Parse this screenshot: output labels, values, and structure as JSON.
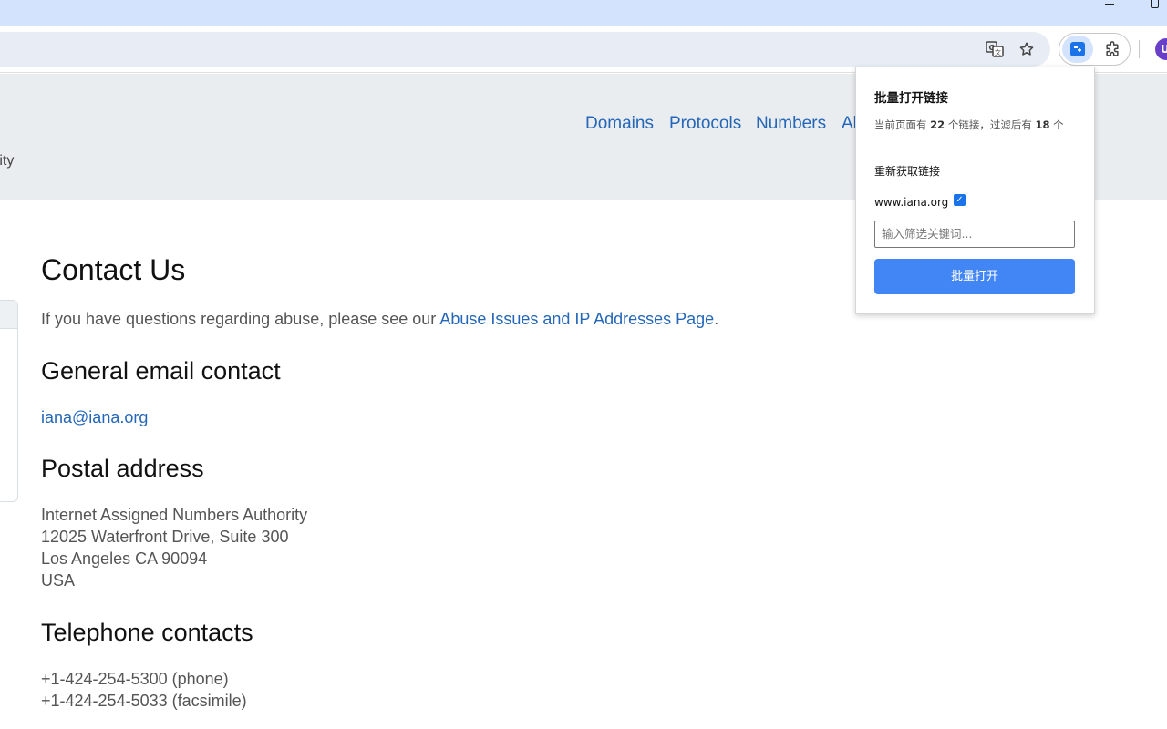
{
  "site": {
    "logo_text_fragment": "rity",
    "nav": {
      "domains": "Domains",
      "protocols": "Protocols",
      "numbers": "Numbers",
      "about_fragment": "Al"
    }
  },
  "main": {
    "title": "Contact Us",
    "abuse_intro": "If you have questions regarding abuse, please see our ",
    "abuse_link": "Abuse Issues and IP Addresses Page",
    "abuse_end": ".",
    "email_heading": "General email contact",
    "email": "iana@iana.org",
    "postal_heading": "Postal address",
    "postal_lines": [
      "Internet Assigned Numbers Authority",
      "12025 Waterfront Drive, Suite 300",
      "Los Angeles CA 90094",
      "USA"
    ],
    "phone_heading": "Telephone contacts",
    "phone_lines": [
      "+1-424-254-5300 (phone)",
      "+1-424-254-5033 (facsimile)"
    ]
  },
  "browser": {
    "avatar_letter": "U"
  },
  "popup": {
    "title": "批量打开链接",
    "info_prefix": "当前页面有 ",
    "info_total": "22",
    "info_mid": " 个链接，过滤后有 ",
    "info_filtered": "18",
    "info_suffix": " 个",
    "refresh_label": "重新获取链接",
    "domain_label": "www.iana.org",
    "domain_checked": true,
    "filter_placeholder": "输入筛选关键词...",
    "open_button": "批量打开"
  },
  "colors": {
    "link": "#2466b8",
    "popup_button": "#4285f4",
    "header_bg": "#eaedef"
  }
}
